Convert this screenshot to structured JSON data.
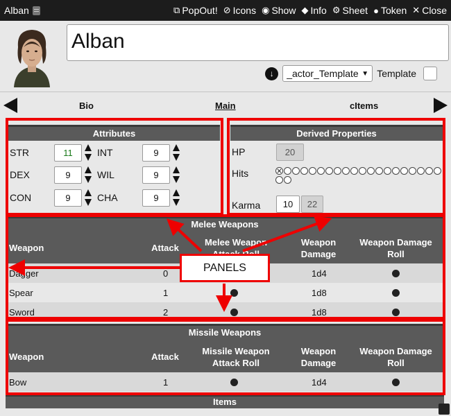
{
  "window": {
    "title": "Alban",
    "actions": [
      {
        "icon": "popout-icon",
        "glyph": "⧉",
        "label": "PopOut!"
      },
      {
        "icon": "icons-toggle-icon",
        "glyph": "⊘",
        "label": "Icons"
      },
      {
        "icon": "eye-icon",
        "glyph": "◉",
        "label": "Show"
      },
      {
        "icon": "tag-icon",
        "glyph": "◆",
        "label": "Info"
      },
      {
        "icon": "gear-icon",
        "glyph": "⚙",
        "label": "Sheet"
      },
      {
        "icon": "user-icon",
        "glyph": "●",
        "label": "Token"
      },
      {
        "icon": "close-icon",
        "glyph": "✕",
        "label": "Close"
      }
    ]
  },
  "header": {
    "name": "Alban",
    "template_select": "_actor_Template",
    "template_label": "Template"
  },
  "tabs": [
    "Bio",
    "Main",
    "cItems"
  ],
  "active_tab": "Main",
  "attributes": {
    "title": "Attributes",
    "items": [
      {
        "label": "STR",
        "value": "11",
        "color": "#1a7a1a"
      },
      {
        "label": "INT",
        "value": "9",
        "color": "#111111"
      },
      {
        "label": "DEX",
        "value": "9",
        "color": "#111111"
      },
      {
        "label": "WIL",
        "value": "9",
        "color": "#111111"
      },
      {
        "label": "CON",
        "value": "9",
        "color": "#111111"
      },
      {
        "label": "CHA",
        "value": "9",
        "color": "#111111"
      }
    ]
  },
  "derived": {
    "title": "Derived Properties",
    "hp_label": "HP",
    "hp_value": "20",
    "hits_label": "Hits",
    "hits_marked": 1,
    "hits_total": 22,
    "karma_label": "Karma",
    "karma_value": "10",
    "karma_max": "22"
  },
  "melee": {
    "title": "Melee Weapons",
    "headers": [
      "Weapon",
      "Attack",
      "Melee Weapon Attack Roll",
      "Weapon Damage",
      "Weapon Damage Roll"
    ],
    "rows": [
      {
        "weapon": "Dagger",
        "attack": "0",
        "damage": "1d4"
      },
      {
        "weapon": "Spear",
        "attack": "1",
        "damage": "1d8"
      },
      {
        "weapon": "Sword",
        "attack": "2",
        "damage": "1d8"
      }
    ]
  },
  "missile": {
    "title": "Missile Weapons",
    "headers": [
      "Weapon",
      "Attack",
      "Missile Weapon Attack Roll",
      "Weapon Damage",
      "Weapon Damage Roll"
    ],
    "rows": [
      {
        "weapon": "Bow",
        "attack": "1",
        "damage": "1d4"
      }
    ]
  },
  "items": {
    "title": "Items"
  },
  "annotation": {
    "label": "PANELS",
    "color": "#e00000"
  }
}
